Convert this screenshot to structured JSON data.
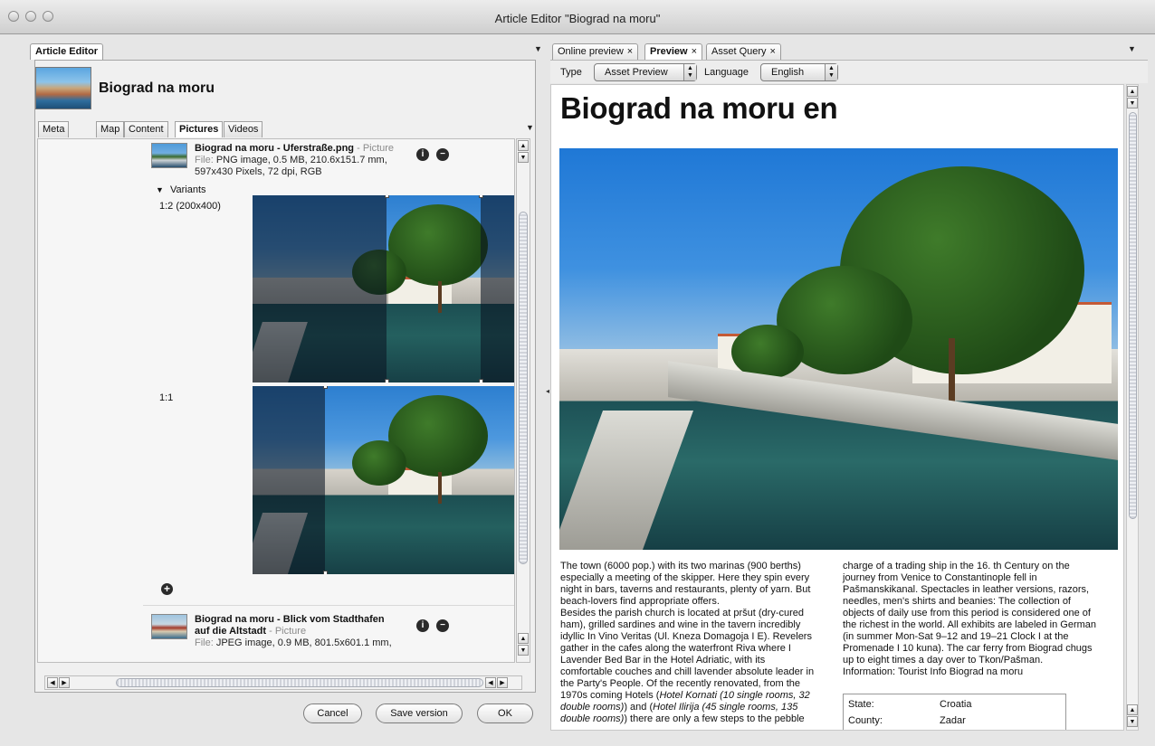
{
  "window": {
    "title": "Article Editor \"Biograd na moru\""
  },
  "left": {
    "panel_tab": "Article Editor",
    "heading": "Biograd na moru",
    "tabs": [
      {
        "label": "Meta data"
      },
      {
        "label": "Map"
      },
      {
        "label": "Content"
      },
      {
        "label": "Pictures"
      },
      {
        "label": "Videos"
      }
    ],
    "assets": [
      {
        "name": "Biograd na moru - Uferstraße.png",
        "type": "- Picture",
        "file_label": "File:",
        "file_line1": "PNG image, 0.5 MB, 210.6x151.7 mm,",
        "file_line2": "597x430 Pixels, 72 dpi, RGB",
        "variants_label": "Variants",
        "variants": [
          {
            "label": "1:2 (200x400)"
          },
          {
            "label": "1:1"
          }
        ]
      },
      {
        "name_line1": "Biograd na moru - Blick vom Stadthafen",
        "name_line2": "auf die Altstadt",
        "type": "- Picture",
        "file_label": "File:",
        "file_line1": "JPEG image, 0.9 MB, 801.5x601.1 mm,"
      }
    ],
    "buttons": {
      "cancel": "Cancel",
      "save_version": "Save version",
      "ok": "OK"
    },
    "icons": {
      "info": "info-icon",
      "remove": "minus-icon",
      "add": "plus-icon",
      "disclosure": "triangle-down-icon"
    }
  },
  "right": {
    "tabs": [
      {
        "label": "Online preview"
      },
      {
        "label": "Preview"
      },
      {
        "label": "Asset Query"
      }
    ],
    "toolbar": {
      "type_label": "Type",
      "type_value": "Asset Preview",
      "language_label": "Language",
      "language_value": "English"
    },
    "preview": {
      "title": "Biograd na moru en",
      "col1": [
        "The town (6000 pop.) with its two marinas (900 berths)",
        "especially a meeting of the skipper. Here they spin every",
        "night in bars, taverns and restaurants, plenty of yarn. But",
        "beach-lovers find appropriate offers.",
        "Besides the parish church is located at pršut (dry-cured",
        "ham), grilled sardines and wine in the tavern incredibly",
        "idyllic In Vino Veritas (Ul. Kneza Domagoja I E). Revelers",
        "gather in the cafes along the waterfront Riva where I",
        "Lavender Bed Bar in the Hotel Adriatic, with its",
        "comfortable couches and chill lavender absolute leader in",
        "the Party's People. Of the recently renovated, from the"
      ],
      "col1_l12_a": "1970s coming Hotels (",
      "col1_l12_b": "Hotel Kornati (10 single rooms, 32",
      "col1_l13_a": "double rooms)",
      "col1_l13_b": ") and (",
      "col1_l13_c": "Hotel Ilirija (45 single rooms, 135",
      "col1_l14_a": "double rooms)",
      "col1_l14_b": ") there are only a few steps to the pebble",
      "col2": [
        "charge of a trading ship in the 16. th Century on the",
        "journey from Venice to Constantinople fell in",
        "Pašmanskikanal. Spectacles in leather versions, razors,",
        "needles, men's shirts and beanies: The collection of",
        "objects of daily use from this period is considered one of",
        "the richest in the world. All exhibits are labeled in German",
        "(in summer Mon-Sat 9–12 and 19–21 Clock I at the",
        "Promenade I 10 kuna). The car ferry from Biograd chugs",
        "up to eight times a day over to Tkon/Pašman.",
        "Information: Tourist Info Biograd na moru"
      ],
      "info_table": [
        {
          "key": "State:",
          "value": "Croatia"
        },
        {
          "key": "County:",
          "value": "Zadar"
        }
      ]
    }
  }
}
